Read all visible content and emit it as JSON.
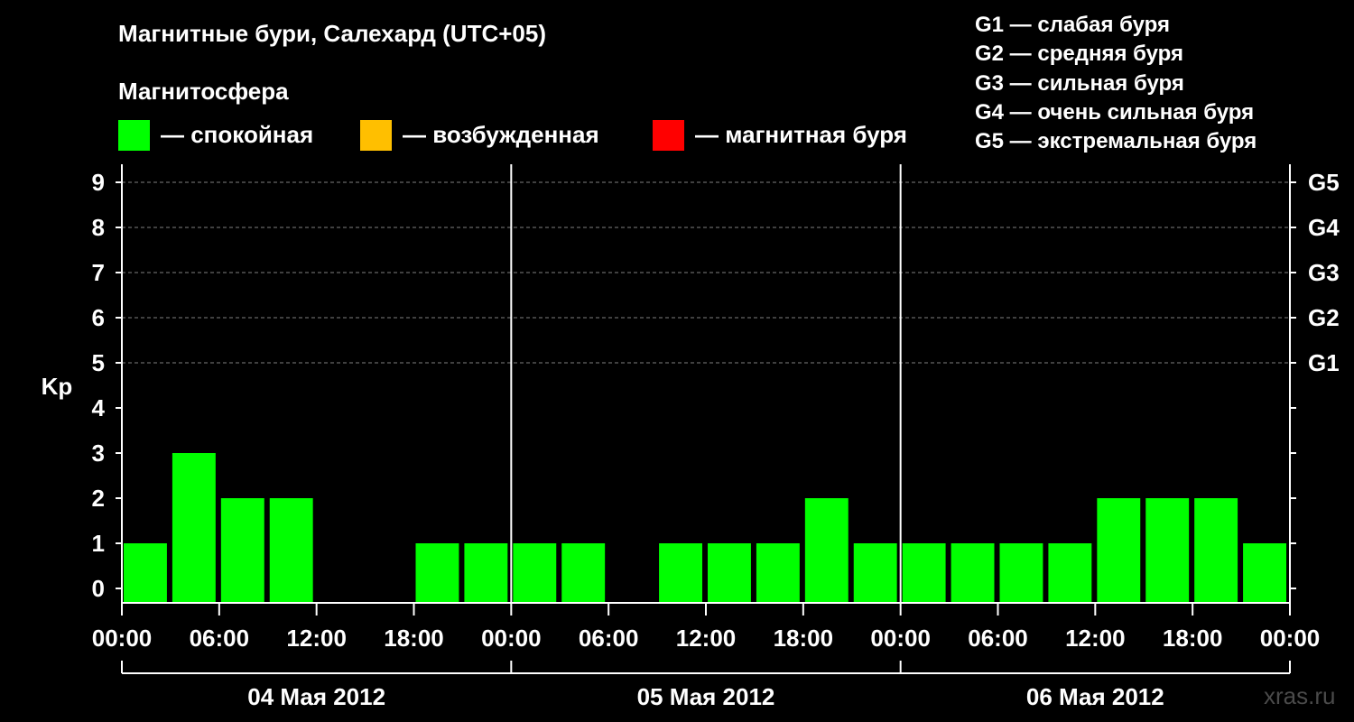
{
  "title": "Магнитные бури, Салехард (UTC+05)",
  "subtitle": "Магнитосфера",
  "legend": [
    {
      "label": "— спокойная",
      "color": "#00ff00"
    },
    {
      "label": "— возбужденная",
      "color": "#ffbf00"
    },
    {
      "label": "— магнитная буря",
      "color": "#ff0000"
    }
  ],
  "g_legend": [
    "G1 — слабая буря",
    "G2 — средняя буря",
    "G3 — сильная буря",
    "G4 — очень сильная буря",
    "G5 — экстремальная буря"
  ],
  "brand": "xras.ru",
  "colors": {
    "background": "#000000",
    "quiet": "#00ff00",
    "axis": "#ffffff",
    "grid": "#808080"
  },
  "chart_data": {
    "type": "bar",
    "ylabel": "Kp",
    "ylim": [
      0,
      9
    ],
    "yticks": [
      0,
      1,
      2,
      3,
      4,
      5,
      6,
      7,
      8,
      9
    ],
    "right_ticks": [
      {
        "value": 5,
        "label": "G1"
      },
      {
        "value": 6,
        "label": "G2"
      },
      {
        "value": 7,
        "label": "G3"
      },
      {
        "value": 8,
        "label": "G4"
      },
      {
        "value": 9,
        "label": "G5"
      }
    ],
    "grid_lines": [
      5,
      6,
      7,
      8,
      9
    ],
    "xticks": [
      "00:00",
      "06:00",
      "12:00",
      "18:00",
      "00:00",
      "06:00",
      "12:00",
      "18:00",
      "00:00",
      "06:00",
      "12:00",
      "18:00",
      "00:00"
    ],
    "days": [
      "04 Мая 2012",
      "05 Мая 2012",
      "06 Мая 2012"
    ],
    "interval_hours": 3,
    "values": [
      1,
      3,
      2,
      2,
      0,
      0,
      1,
      1,
      1,
      1,
      0,
      1,
      1,
      1,
      2,
      1,
      1,
      1,
      1,
      1,
      2,
      2,
      2,
      1
    ]
  }
}
